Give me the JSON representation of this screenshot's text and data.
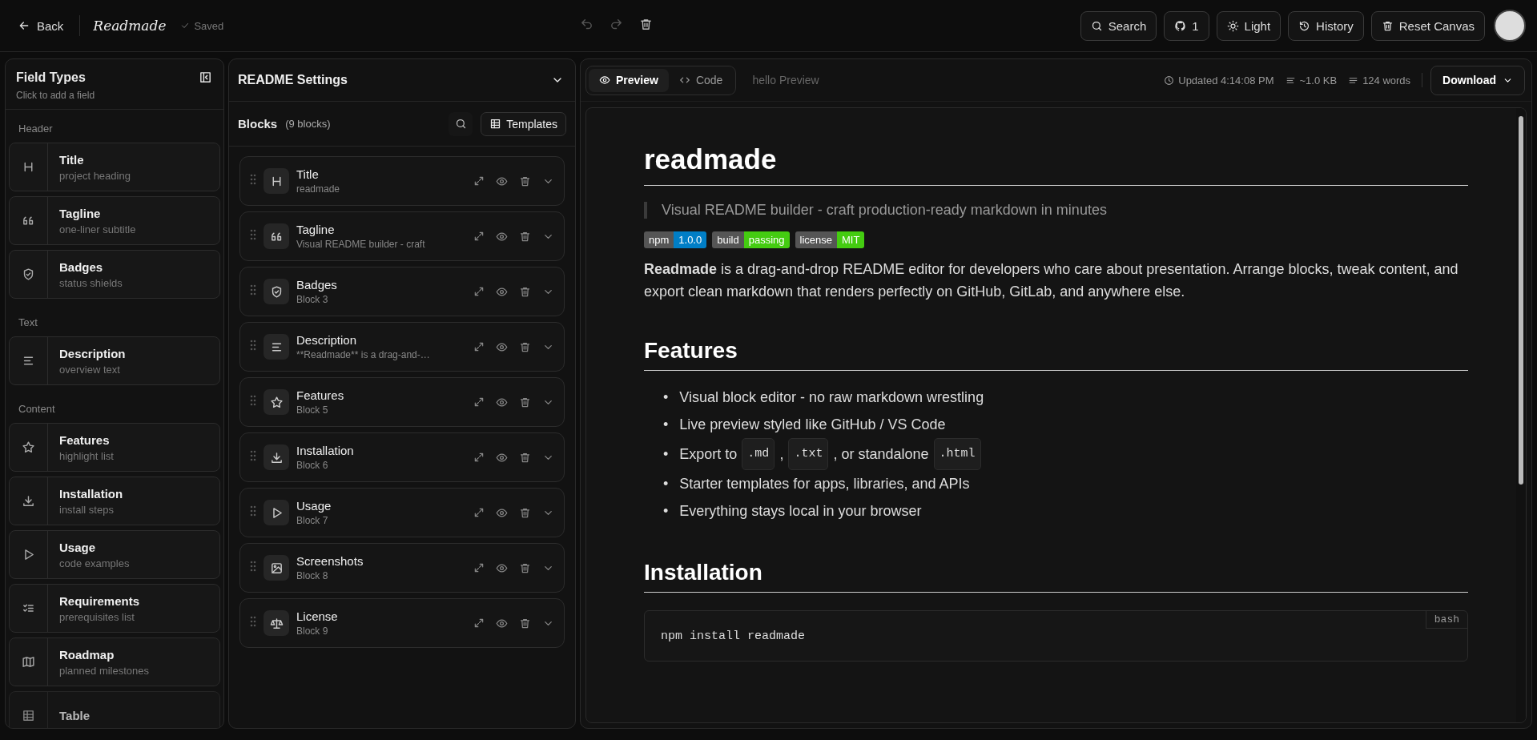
{
  "topbar": {
    "back": "Back",
    "logo": "Readmade",
    "status": "Saved",
    "undo_disabled": true,
    "redo_disabled": true,
    "buttons": [
      {
        "kind": "search",
        "label": "Search"
      },
      {
        "kind": "github",
        "label": "1"
      },
      {
        "kind": "theme",
        "label": "Light"
      },
      {
        "kind": "history",
        "label": "History"
      },
      {
        "kind": "reset",
        "label": "Reset Canvas"
      }
    ]
  },
  "field_types": {
    "title": "Field Types",
    "subtitle": "Click to add a field",
    "groups": [
      {
        "label": "Header",
        "items": [
          {
            "kind": "heading",
            "name": "Title",
            "desc": "project heading"
          },
          {
            "kind": "quote",
            "name": "Tagline",
            "desc": "one-liner subtitle"
          },
          {
            "kind": "shield",
            "name": "Badges",
            "desc": "status shields"
          }
        ]
      },
      {
        "label": "Text",
        "items": [
          {
            "kind": "lines",
            "name": "Description",
            "desc": "overview text"
          }
        ]
      },
      {
        "label": "Content",
        "items": [
          {
            "kind": "star",
            "name": "Features",
            "desc": "highlight list"
          },
          {
            "kind": "download",
            "name": "Installation",
            "desc": "install steps"
          },
          {
            "kind": "play",
            "name": "Usage",
            "desc": "code examples"
          },
          {
            "kind": "checklist",
            "name": "Requirements",
            "desc": "prerequisites list"
          },
          {
            "kind": "map",
            "name": "Roadmap",
            "desc": "planned milestones"
          },
          {
            "kind": "table",
            "name": "Table"
          }
        ]
      }
    ]
  },
  "settings": {
    "title": "README Settings",
    "blocks_label": "Blocks",
    "blocks_count": "(9 blocks)",
    "templates": "Templates",
    "blocks": [
      {
        "kind": "heading",
        "name": "Title",
        "sub": "readmade"
      },
      {
        "kind": "quote",
        "name": "Tagline",
        "sub": "Visual README builder - craft"
      },
      {
        "kind": "shield",
        "name": "Badges",
        "sub": "Block 3"
      },
      {
        "kind": "lines",
        "name": "Description",
        "sub": "**Readmade** is a drag-and-…"
      },
      {
        "kind": "star",
        "name": "Features",
        "sub": "Block 5"
      },
      {
        "kind": "download",
        "name": "Installation",
        "sub": "Block 6"
      },
      {
        "kind": "play",
        "name": "Usage",
        "sub": "Block 7"
      },
      {
        "kind": "image",
        "name": "Screenshots",
        "sub": "Block 8"
      },
      {
        "kind": "scale",
        "name": "License",
        "sub": "Block 9"
      }
    ]
  },
  "preview": {
    "tabs": [
      {
        "label": "Preview",
        "kind": "eye",
        "selected": true
      },
      {
        "label": "Code",
        "kind": "code",
        "selected": false
      }
    ],
    "filename": "hello Preview",
    "updated": "Updated 4:14:08 PM",
    "size": "~1.0 KB",
    "words": "124 words",
    "download": "Download",
    "doc": {
      "title": "readmade",
      "tagline": "Visual README builder - craft production-ready markdown in minutes",
      "badges": [
        {
          "label": "npm",
          "value": "1.0.0",
          "color": "#007ec6"
        },
        {
          "label": "build",
          "value": "passing",
          "color": "#4c1"
        },
        {
          "label": "license",
          "value": "MIT",
          "color": "#44cc11"
        }
      ],
      "description": "**Readmade** is a drag-and-drop README editor for developers who care about presentation. Arrange blocks, tweak content, and export clean markdown that renders perfectly on GitHub, GitLab, and anywhere else.",
      "features_heading": "Features",
      "features": [
        {
          "bullet": "•",
          "parts": [
            {
              "kind": "text",
              "text": "Visual block editor - no raw markdown wrestling"
            }
          ]
        },
        {
          "bullet": "•",
          "parts": [
            {
              "kind": "text",
              "text": "Live preview styled like GitHub / VS Code"
            }
          ]
        },
        {
          "bullet": "•",
          "parts": [
            {
              "kind": "text",
              "text": "Export to"
            },
            {
              "kind": "code",
              "text": ".md"
            },
            {
              "kind": "text",
              "text": ","
            },
            {
              "kind": "code",
              "text": ".txt"
            },
            {
              "kind": "text",
              "text": ", or standalone"
            },
            {
              "kind": "code",
              "text": ".html"
            }
          ]
        },
        {
          "bullet": "•",
          "parts": [
            {
              "kind": "text",
              "text": "Starter templates for apps, libraries, and APIs"
            }
          ]
        },
        {
          "bullet": "•",
          "parts": [
            {
              "kind": "text",
              "text": "Everything stays local in your browser"
            }
          ]
        }
      ],
      "install_heading": "Installation",
      "code_lang": "bash",
      "code": "npm install readmade"
    }
  }
}
